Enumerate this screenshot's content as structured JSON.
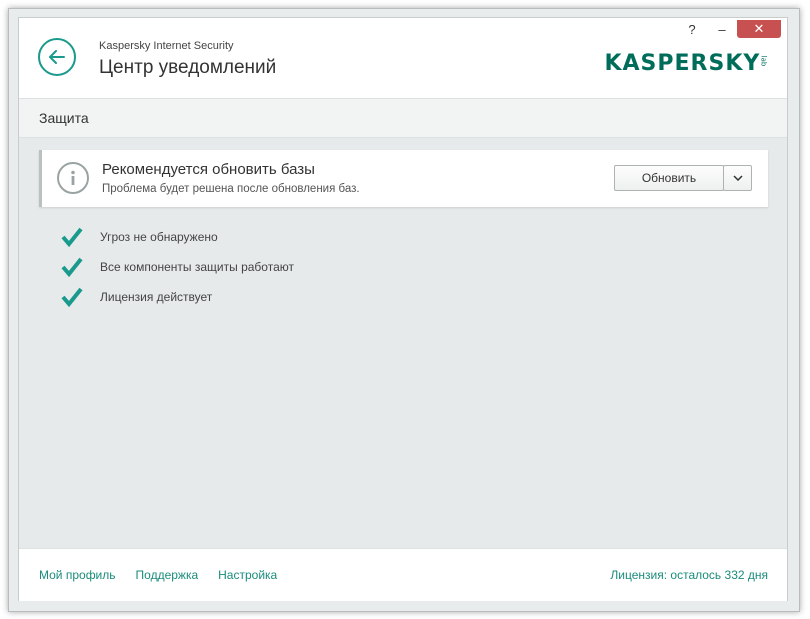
{
  "window": {
    "help_label": "?",
    "minimize_label": "–",
    "close_label": "✕"
  },
  "header": {
    "app_name": "Kaspersky Internet Security",
    "title": "Центр уведомлений",
    "logo_text": "KASPERSKY",
    "logo_sub": "lab",
    "back_icon": "back-arrow-icon"
  },
  "section": {
    "title": "Защита"
  },
  "notice": {
    "icon": "info-icon",
    "title": "Рекомендуется обновить базы",
    "text": "Проблема будет решена после обновления баз.",
    "button_label": "Обновить",
    "dropdown_icon": "chevron-down-icon"
  },
  "status_items": [
    {
      "label": "Угроз не обнаружено",
      "icon": "check-icon"
    },
    {
      "label": "Все компоненты защиты работают",
      "icon": "check-icon"
    },
    {
      "label": "Лицензия действует",
      "icon": "check-icon"
    }
  ],
  "footer": {
    "links": [
      "Мой профиль",
      "Поддержка",
      "Настройка"
    ],
    "license": "Лицензия: осталось 332 дня"
  },
  "colors": {
    "accent": "#1a9a8c",
    "close": "#c75050",
    "background": "#e7eaeb"
  }
}
